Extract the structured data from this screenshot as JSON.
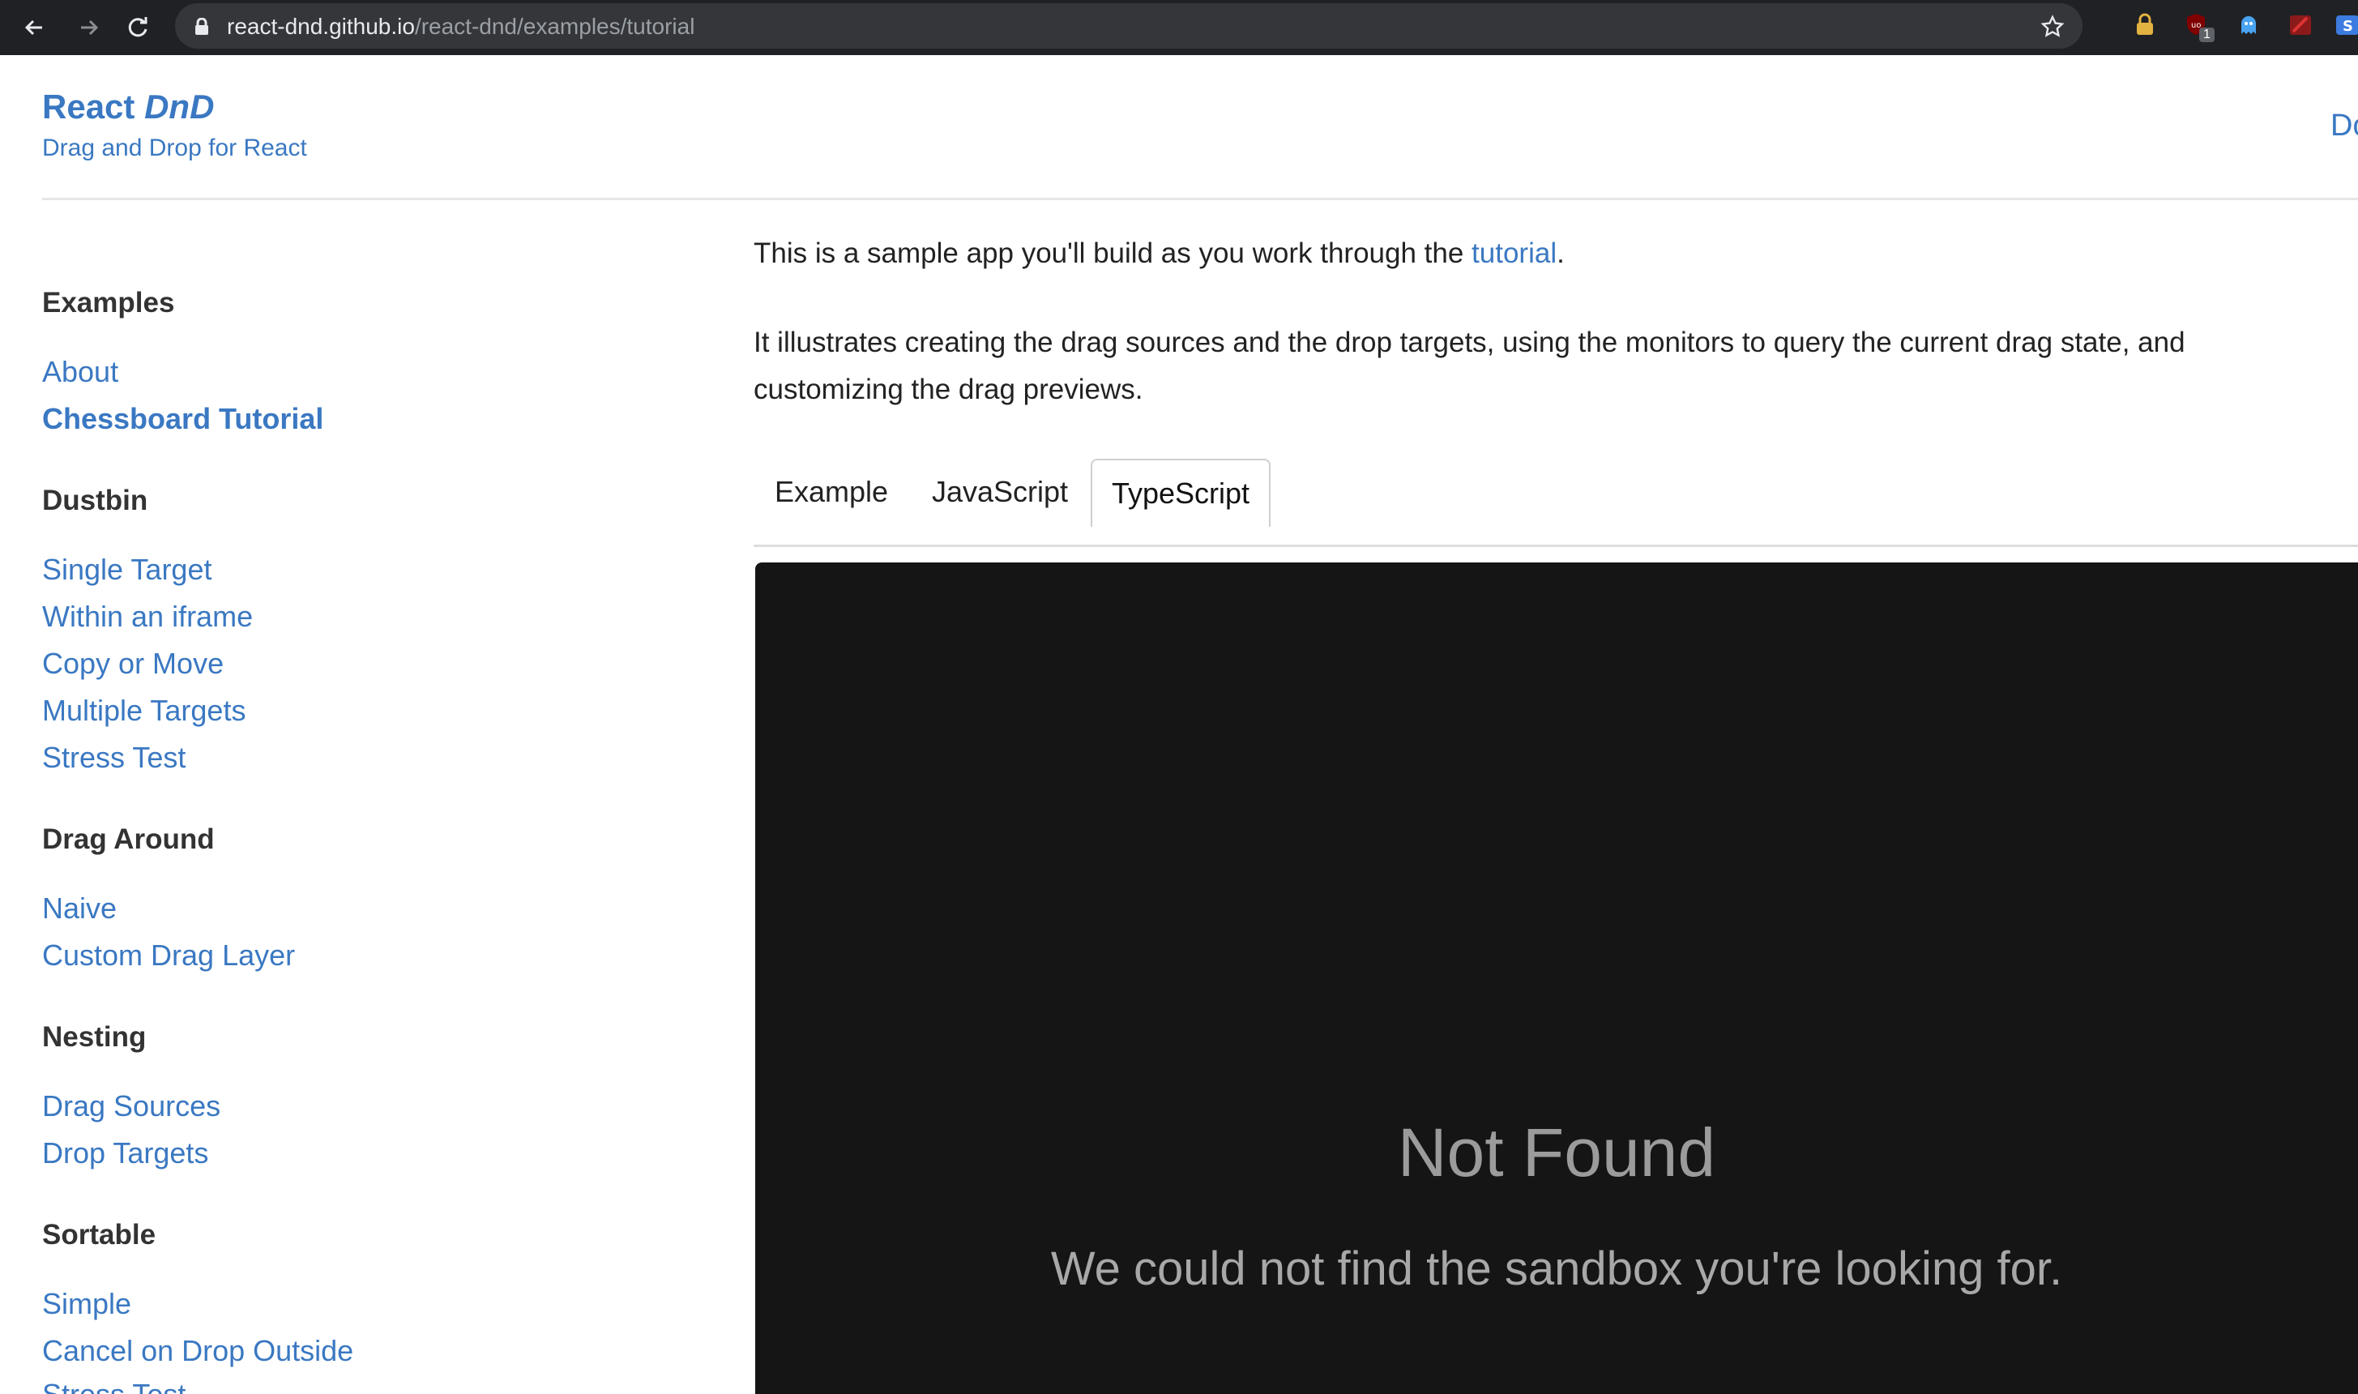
{
  "browser": {
    "url_host": "react-dnd.github.io",
    "url_path": "/react-dnd/examples/tutorial",
    "extension_badge": "1"
  },
  "header": {
    "brand_main": "React",
    "brand_italic": "DnD",
    "tagline": "Drag and Drop for React",
    "top_link": "Do"
  },
  "sidebar": {
    "sections": [
      {
        "heading": "Examples",
        "items": [
          "About",
          "Chessboard Tutorial"
        ]
      },
      {
        "heading": "Dustbin",
        "items": [
          "Single Target",
          "Within an iframe",
          "Copy or Move",
          "Multiple Targets",
          "Stress Test"
        ]
      },
      {
        "heading": "Drag Around",
        "items": [
          "Naive",
          "Custom Drag Layer"
        ]
      },
      {
        "heading": "Nesting",
        "items": [
          "Drag Sources",
          "Drop Targets"
        ]
      },
      {
        "heading": "Sortable",
        "items": [
          "Simple",
          "Cancel on Drop Outside",
          "Stress Test"
        ]
      }
    ],
    "active_item": "Chessboard Tutorial"
  },
  "main": {
    "intro_before": "This is a sample app you'll build as you work through the ",
    "intro_link": "tutorial",
    "intro_after": ".",
    "description": "It illustrates creating the drag sources and the drop targets, using the monitors to query the current drag state, and customizing the drag previews.",
    "tabs": [
      "Example",
      "JavaScript",
      "TypeScript"
    ],
    "active_tab": "TypeScript",
    "sandbox": {
      "title": "Not Found",
      "message": "We could not find the sandbox you're looking for."
    }
  },
  "colors": {
    "link": "#3a78c2",
    "chrome_bg": "#202124",
    "sandbox_bg": "#151515"
  }
}
